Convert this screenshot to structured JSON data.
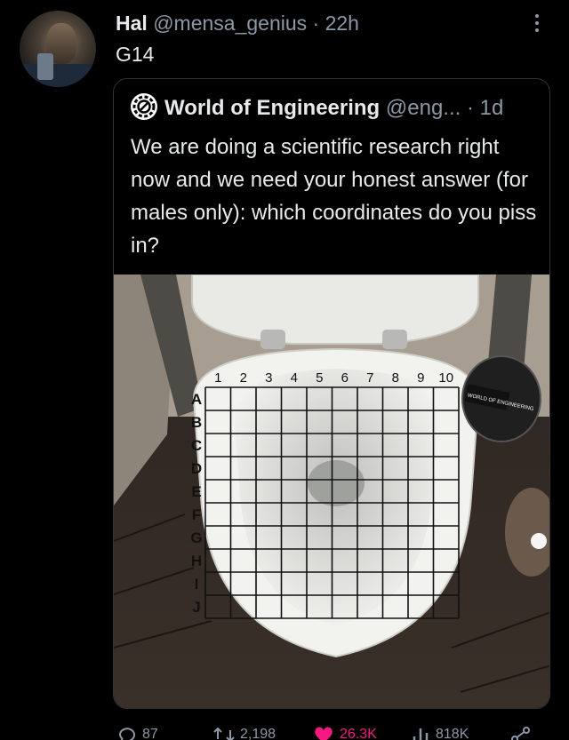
{
  "tweet": {
    "author_name": "Hal",
    "author_handle": "@mensa_genius",
    "separator": "·",
    "time": "22h",
    "text": "G14",
    "more_icon": "more-options-icon"
  },
  "quoted_tweet": {
    "author_name": "World of Engineering",
    "author_handle": "@eng...",
    "separator": "·",
    "time": "1d",
    "text": "We are doing a scientific research right now and we need your honest answer (for males only): which coordinates do you piss in?",
    "logo_icon": "gear-logo-icon",
    "image": {
      "grid_columns": [
        "1",
        "2",
        "3",
        "4",
        "5",
        "6",
        "7",
        "8",
        "9",
        "10"
      ],
      "grid_rows": [
        "A",
        "B",
        "C",
        "D",
        "E",
        "F",
        "G",
        "H",
        "I",
        "J"
      ],
      "bin_sticker": "WORLD OF ENGINEERING"
    }
  },
  "actions": {
    "reply_count": "87",
    "retweet_count": "2,198",
    "like_count": "26.3K",
    "view_count": "818K",
    "like_color": "#f91880",
    "muted_color": "#8b98a5"
  }
}
